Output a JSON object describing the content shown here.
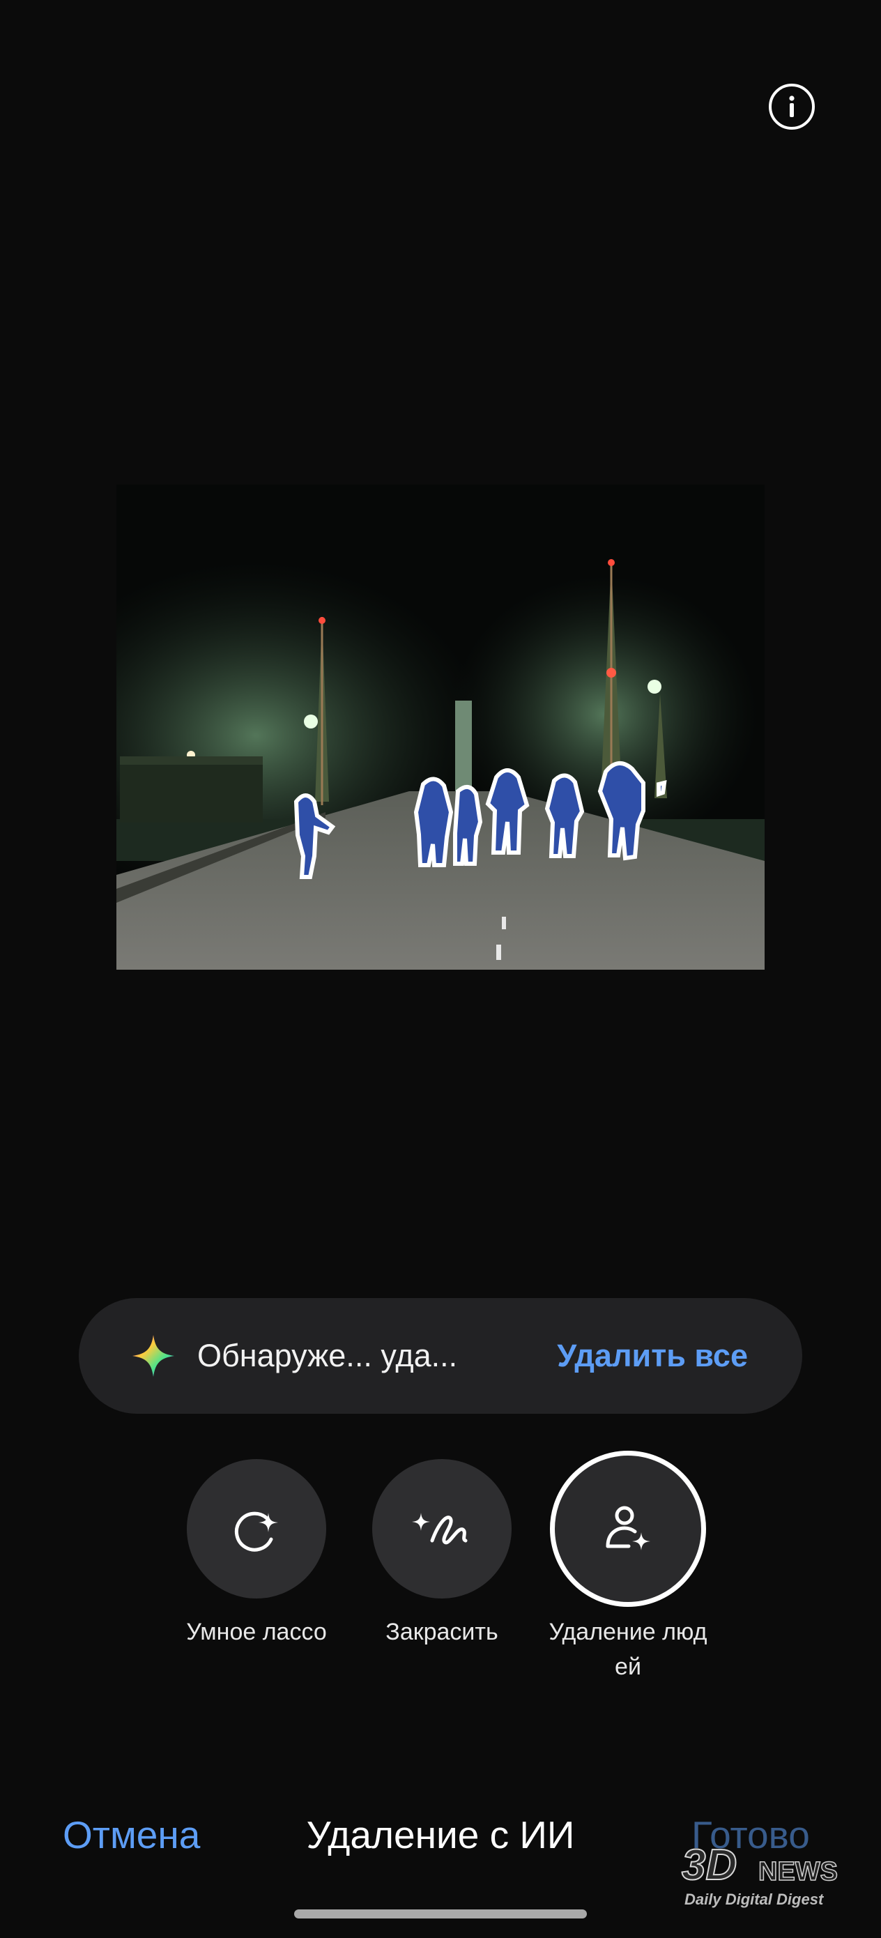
{
  "header": {
    "info_icon": "info-icon"
  },
  "banner": {
    "icon": "ai-sparkle-icon",
    "text": "Обнаруже... уда...",
    "delete_all_label": "Удалить все"
  },
  "tools": [
    {
      "icon": "smart-lasso-icon",
      "label": "Умное лассо",
      "active": false
    },
    {
      "icon": "paint-over-icon",
      "label": "Закрасить",
      "active": false
    },
    {
      "icon": "remove-people-icon",
      "label": "Удаление люд\nей",
      "active": true
    }
  ],
  "bottom_bar": {
    "cancel_label": "Отмена",
    "title": "Удаление с ИИ",
    "done_label": "Готово"
  },
  "watermark": {
    "logo": "3D",
    "news": "NEWS",
    "subtitle": "Daily Digital Digest"
  },
  "colors": {
    "accent": "#5d9df5",
    "background": "#0b0b0b",
    "banner_bg": "#222224",
    "tool_bg": "#2e2e30",
    "person_highlight": "#2f4fa8"
  }
}
